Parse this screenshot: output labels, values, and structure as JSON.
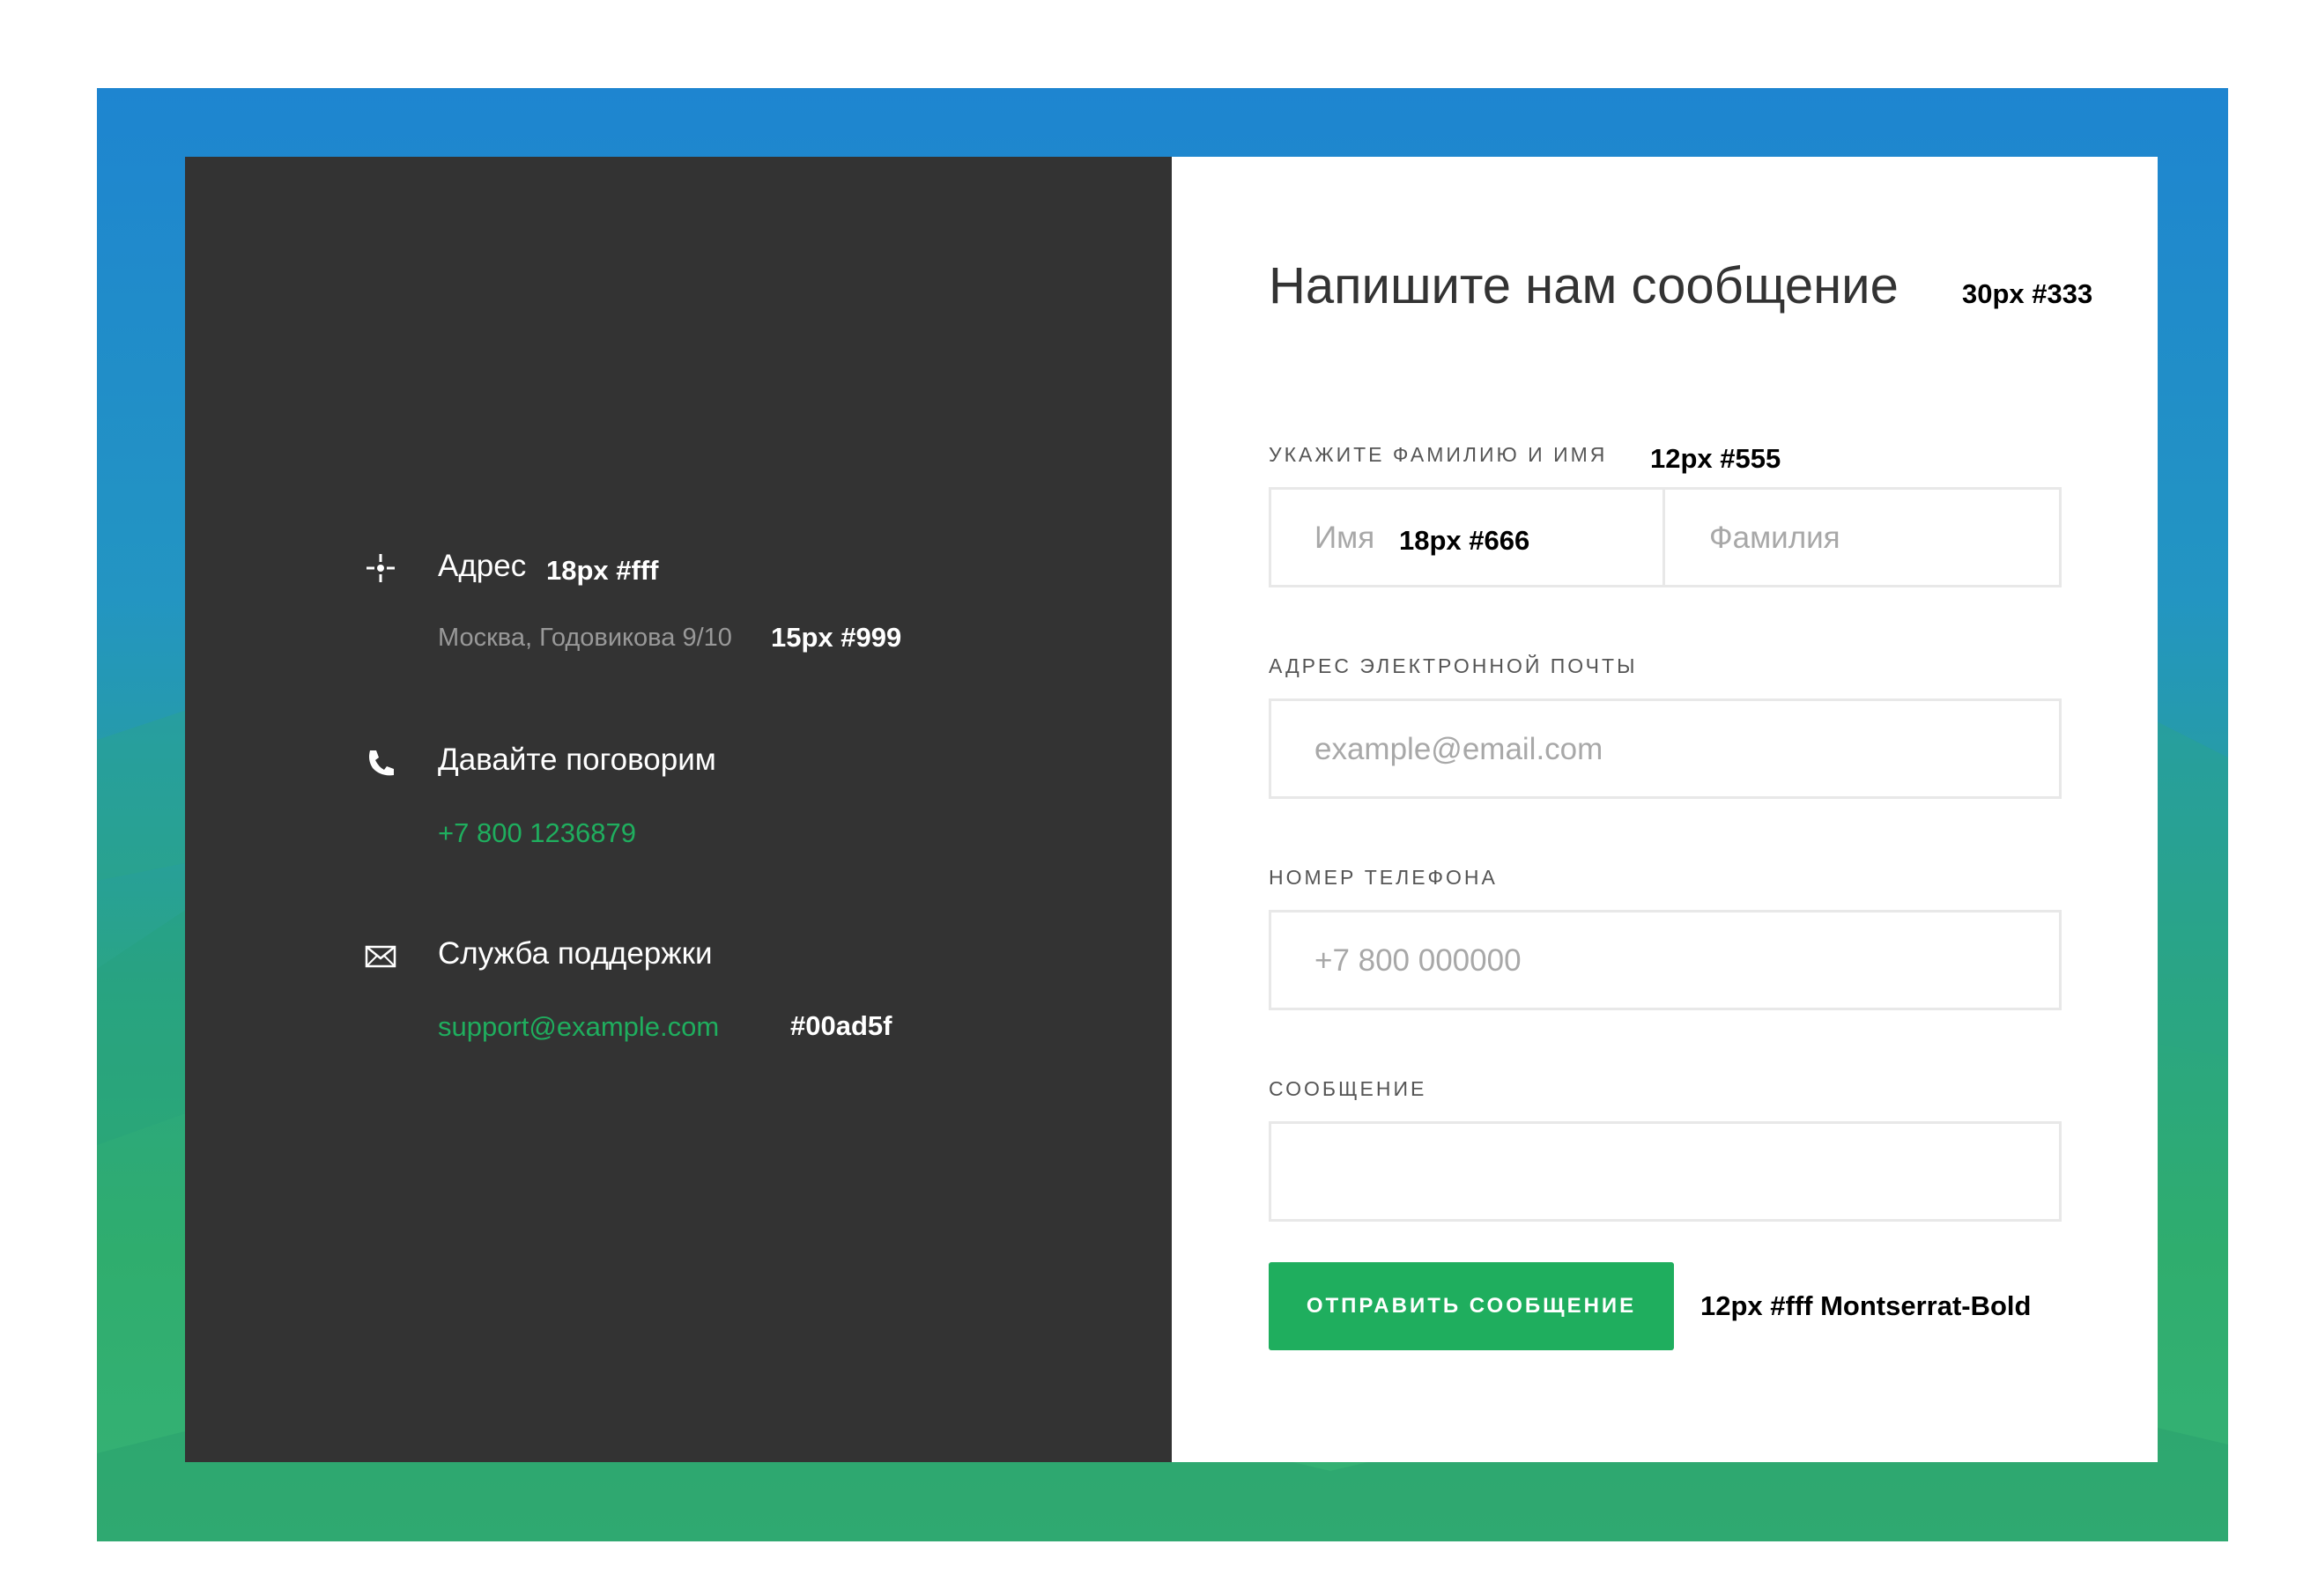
{
  "colors": {
    "dark_panel": "#333333",
    "accent_green": "#1fae5e",
    "label_grey": "#555555",
    "placeholder_grey": "#a8a8a8",
    "sub_grey": "#999999"
  },
  "contact": {
    "address": {
      "icon": "location-crosshair-icon",
      "title": "Адрес",
      "value": "Москва, Годовикова 9/10"
    },
    "phone": {
      "icon": "phone-icon",
      "title": "Давайте поговорим",
      "value": "+7 800 1236879"
    },
    "support": {
      "icon": "envelope-icon",
      "title": "Служба поддержки",
      "value": "support@example.com"
    }
  },
  "form": {
    "title": "Напишите нам сообщение",
    "name_label": "Укажите фамилию и имя",
    "first_name_placeholder": "Имя",
    "last_name_placeholder": "Фамилия",
    "email_label": "Адрес электронной почты",
    "email_placeholder": "example@email.com",
    "phone_label": "Номер телефона",
    "phone_placeholder": "+7 800 000000",
    "message_label": "Сообщение",
    "message_placeholder": "",
    "submit_label": "Отправить сообщение"
  },
  "annotations": {
    "title_spec": "30px #333",
    "label_spec": "12px #555",
    "input_spec": "18px #666",
    "info_title_spec": "18px #fff",
    "info_sub_spec": "15px  #999",
    "accent_spec": "#00ad5f",
    "button_spec": "12px #fff Montserrat-Bold"
  }
}
